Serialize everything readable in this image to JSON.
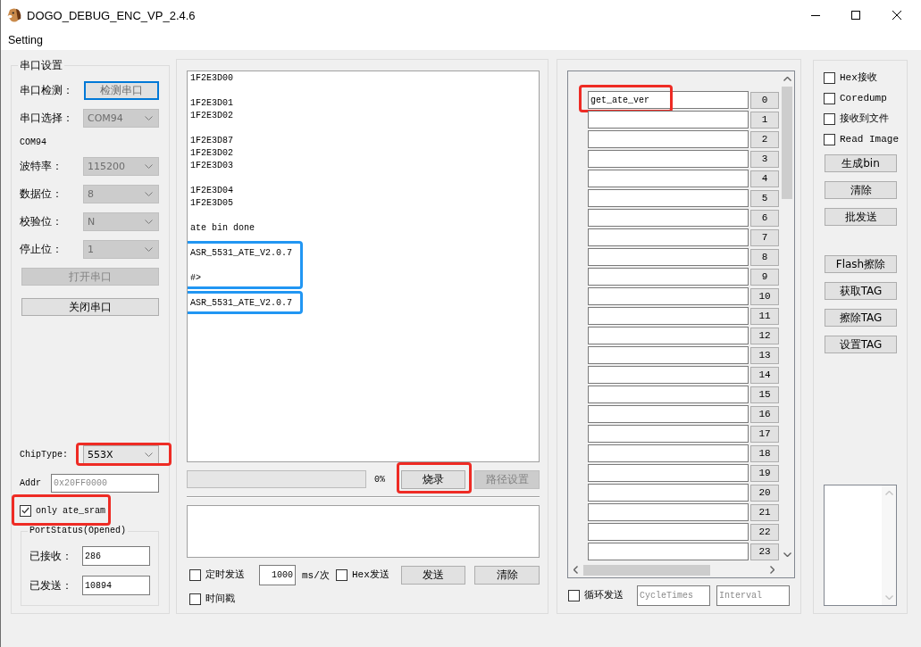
{
  "window": {
    "title": "DOGO_DEBUG_ENC_VP_2.4.6"
  },
  "menu": [
    {
      "label": "Setting"
    }
  ],
  "serial_settings": {
    "title": "串口设置",
    "rows": [
      {
        "kind": "button",
        "label": "串口检测：",
        "button": "检测串口",
        "focused": true
      },
      {
        "kind": "select",
        "label": "串口选择：",
        "value": "COM94",
        "disabled": true
      },
      {
        "kind": "text",
        "text": "COM94"
      },
      {
        "kind": "select",
        "label": "波特率：",
        "value": "115200",
        "disabled": true
      },
      {
        "kind": "select",
        "label": "数据位：",
        "value": "8",
        "disabled": true
      },
      {
        "kind": "select",
        "label": "校验位：",
        "value": "N",
        "disabled": true
      },
      {
        "kind": "select",
        "label": "停止位：",
        "value": "1",
        "disabled": true
      }
    ],
    "port_buttons": [
      {
        "label": "打开串口",
        "disabled": true
      },
      {
        "label": "关闭串口",
        "disabled": false
      }
    ],
    "chip_type": {
      "label": "ChipType:",
      "value": "553X",
      "disabled": false,
      "highlight": {
        "color": "#ee2b24"
      }
    },
    "addr": {
      "label": "Addr",
      "placeholder": "0x20FF0000"
    },
    "only_ate_sram": {
      "label": "only ate_sram",
      "checked": true,
      "highlight": {
        "color": "#ee2b24"
      }
    },
    "port_status": {
      "title": "PortStatus(Opened)",
      "fields": [
        {
          "label": "已接收：",
          "value": "286"
        },
        {
          "label": "已发送：",
          "value": "10894"
        }
      ]
    }
  },
  "receive_log": {
    "sections": [
      {
        "paragraphs": [
          [
            "1F2E3D00"
          ],
          [
            "1F2E3D01",
            "1F2E3D02"
          ],
          [
            "1F2E3D87",
            "1F2E3D02",
            "1F2E3D03"
          ],
          [
            "1F2E3D04",
            "1F2E3D05"
          ],
          [
            "ate bin done"
          ]
        ]
      },
      {
        "highlight": {
          "color": "#2196f3"
        },
        "paragraphs": [
          [
            "ASR_5531_ATE_V2.0.7"
          ],
          [
            "#>"
          ]
        ]
      },
      {
        "highlight": {
          "color": "#2196f3"
        },
        "paragraphs": [
          [
            "ASR_5531_ATE_V2.0.7"
          ]
        ]
      }
    ]
  },
  "burn": {
    "progress": {
      "level": 0,
      "reading": "0%"
    },
    "buttons": [
      {
        "label": "烧录",
        "disabled": false,
        "highlight": {
          "color": "#ee2b24"
        }
      },
      {
        "label": "路径设置",
        "disabled": true
      }
    ]
  },
  "send": {
    "timed_send": {
      "label": "定时发送",
      "checked": false
    },
    "period": {
      "value": "1000",
      "unit": "ms/次"
    },
    "hex_send": {
      "label": "Hex发送",
      "checked": false
    },
    "buttons": [
      {
        "label": "发送"
      },
      {
        "label": "清除"
      }
    ],
    "timestamp": {
      "label": "时间戳",
      "checked": false
    }
  },
  "command_list": {
    "rows": [
      {
        "value": "get_ate_ver",
        "button": "0",
        "highlight": {
          "color": "#ee2b24"
        }
      },
      {
        "button": "1"
      },
      {
        "button": "2"
      },
      {
        "button": "3"
      },
      {
        "button": "4"
      },
      {
        "button": "5"
      },
      {
        "button": "6"
      },
      {
        "button": "7"
      },
      {
        "button": "8"
      },
      {
        "button": "9"
      },
      {
        "button": "10"
      },
      {
        "button": "11"
      },
      {
        "button": "12"
      },
      {
        "button": "13"
      },
      {
        "button": "14"
      },
      {
        "button": "15"
      },
      {
        "button": "16"
      },
      {
        "button": "17"
      },
      {
        "button": "18"
      },
      {
        "button": "19"
      },
      {
        "button": "20"
      },
      {
        "button": "21"
      },
      {
        "button": "22"
      },
      {
        "button": "23"
      }
    ]
  },
  "loop_send": {
    "label": "循环发送",
    "checked": false,
    "fields": [
      {
        "placeholder": "CycleTimes"
      },
      {
        "placeholder": "Interval"
      }
    ]
  },
  "tools": {
    "checkboxes": [
      {
        "label": "Hex接收",
        "checked": false
      },
      {
        "label": "Coredump",
        "checked": false
      },
      {
        "label": "接收到文件",
        "checked": false
      },
      {
        "label": "Read Image",
        "checked": false
      }
    ],
    "buttons": [
      {
        "label": "生成bin"
      },
      {
        "label": "清除"
      },
      {
        "label": "批发送"
      }
    ],
    "flash_buttons": [
      {
        "label": "Flash擦除"
      },
      {
        "label": "获取TAG"
      },
      {
        "label": "擦除TAG"
      },
      {
        "label": "设置TAG"
      }
    ]
  }
}
